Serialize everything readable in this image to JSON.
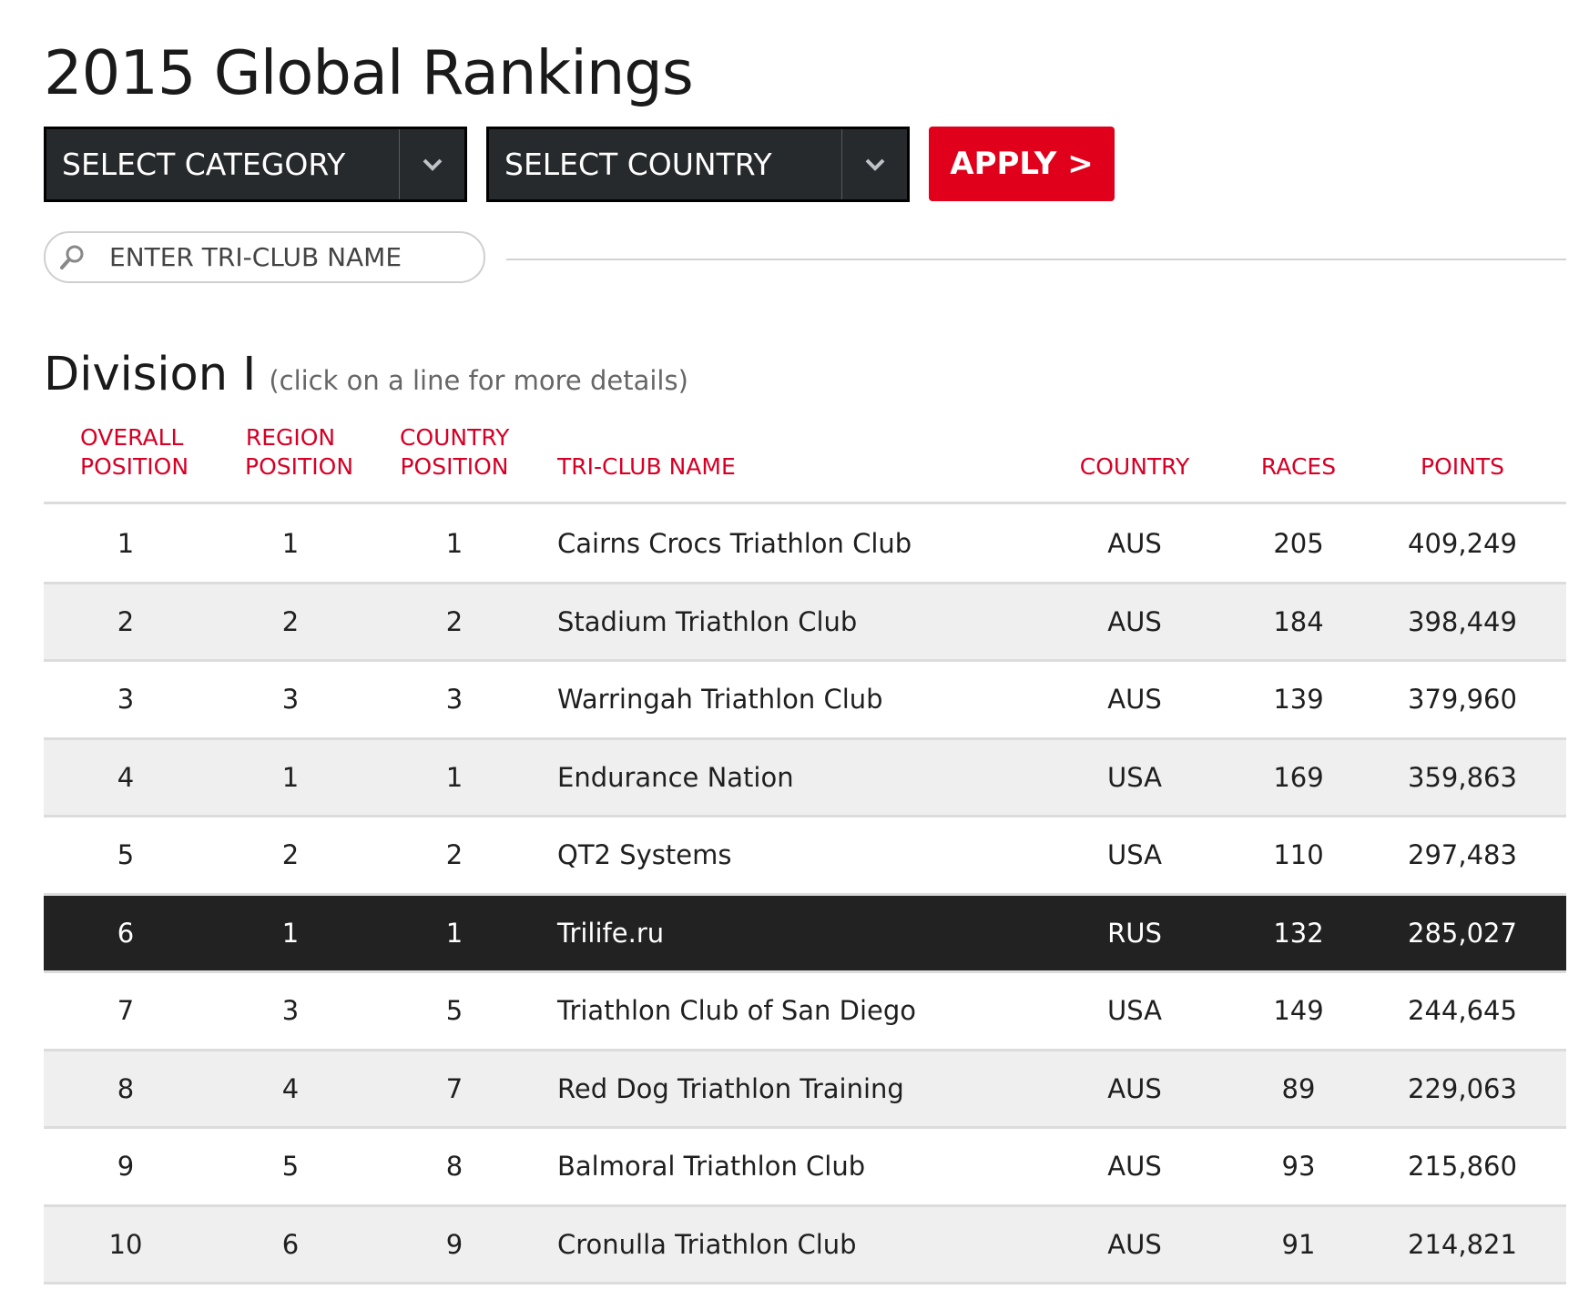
{
  "page": {
    "title": "2015 Global Rankings"
  },
  "filters": {
    "category_label": "SELECT CATEGORY",
    "country_label": "SELECT COUNTRY",
    "apply_label": "APPLY >"
  },
  "search": {
    "placeholder": "ENTER TRI-CLUB NAME"
  },
  "section": {
    "title": "Division I",
    "note": "(click on a line for more details)"
  },
  "table": {
    "headers": {
      "overall": [
        "OVERALL",
        "POSITION"
      ],
      "region": [
        "REGION",
        "POSITION"
      ],
      "country_position": [
        "COUNTRY",
        "POSITION"
      ],
      "name": "TRI-CLUB NAME",
      "country": "COUNTRY",
      "races": "RACES",
      "points": "POINTS"
    },
    "rows": [
      {
        "overall": "1",
        "region": "1",
        "country_position": "1",
        "name": "Cairns Crocs Triathlon Club",
        "country": "AUS",
        "races": "205",
        "points": "409,249"
      },
      {
        "overall": "2",
        "region": "2",
        "country_position": "2",
        "name": "Stadium Triathlon Club",
        "country": "AUS",
        "races": "184",
        "points": "398,449"
      },
      {
        "overall": "3",
        "region": "3",
        "country_position": "3",
        "name": "Warringah Triathlon Club",
        "country": "AUS",
        "races": "139",
        "points": "379,960"
      },
      {
        "overall": "4",
        "region": "1",
        "country_position": "1",
        "name": "Endurance Nation",
        "country": "USA",
        "races": "169",
        "points": "359,863"
      },
      {
        "overall": "5",
        "region": "2",
        "country_position": "2",
        "name": "QT2 Systems",
        "country": "USA",
        "races": "110",
        "points": "297,483"
      },
      {
        "overall": "6",
        "region": "1",
        "country_position": "1",
        "name": "Trilife.ru",
        "country": "RUS",
        "races": "132",
        "points": "285,027",
        "highlighted": true
      },
      {
        "overall": "7",
        "region": "3",
        "country_position": "5",
        "name": "Triathlon Club of San Diego",
        "country": "USA",
        "races": "149",
        "points": "244,645"
      },
      {
        "overall": "8",
        "region": "4",
        "country_position": "7",
        "name": "Red Dog Triathlon Training",
        "country": "AUS",
        "races": "89",
        "points": "229,063"
      },
      {
        "overall": "9",
        "region": "5",
        "country_position": "8",
        "name": "Balmoral Triathlon Club",
        "country": "AUS",
        "races": "93",
        "points": "215,860"
      },
      {
        "overall": "10",
        "region": "6",
        "country_position": "9",
        "name": "Cronulla Triathlon Club",
        "country": "AUS",
        "races": "91",
        "points": "214,821"
      }
    ]
  },
  "colors": {
    "accent": "#e0001b",
    "header_text": "#d60026",
    "select_bg": "#272a2d",
    "highlight_row": "#222222",
    "shaded_row": "#efefef"
  },
  "icons": {
    "search": "search-icon",
    "dropdown": "chevron-down-icon"
  }
}
